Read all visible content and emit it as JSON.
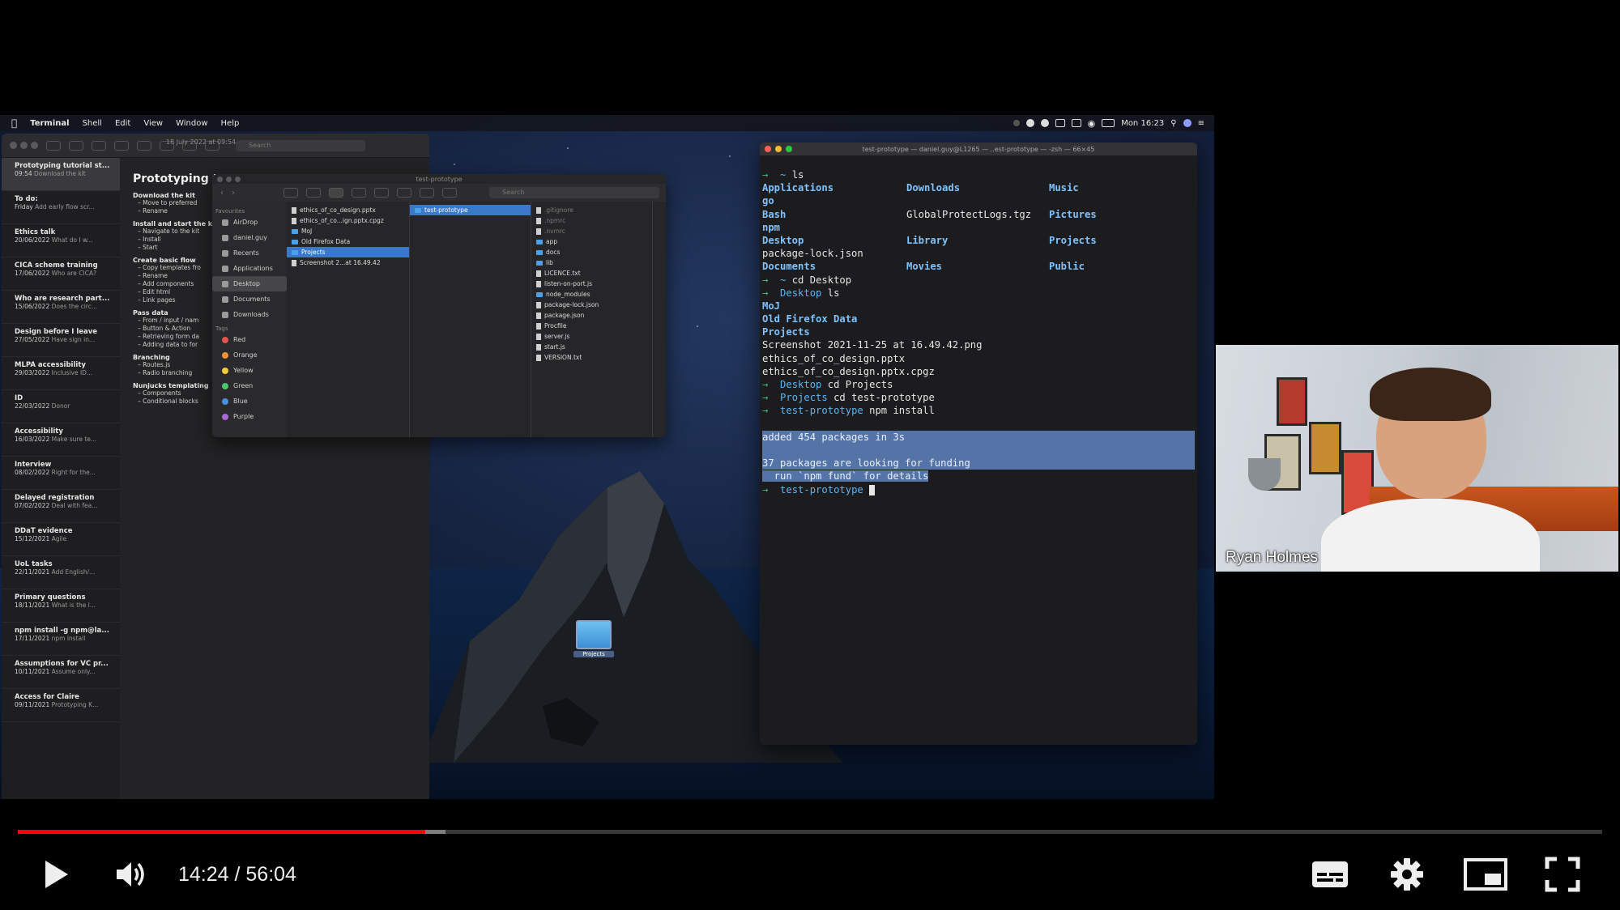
{
  "menubar": {
    "app": "Terminal",
    "items": [
      "Shell",
      "Edit",
      "View",
      "Window",
      "Help"
    ],
    "clock": "Mon 16:23"
  },
  "notes": {
    "search_placeholder": "Search",
    "list": [
      {
        "title": "Prototyping tutorial st...",
        "date": "09:54",
        "preview": "Download the kit"
      },
      {
        "title": "To do:",
        "date": "Friday",
        "preview": "Add early flow scr..."
      },
      {
        "title": "Ethics talk",
        "date": "20/06/2022",
        "preview": "What do I w..."
      },
      {
        "title": "CICA scheme training",
        "date": "17/06/2022",
        "preview": "Who are CICA?"
      },
      {
        "title": "Who are research part...",
        "date": "15/06/2022",
        "preview": "Does the circ..."
      },
      {
        "title": "Design before I leave",
        "date": "27/05/2022",
        "preview": "Have sign in..."
      },
      {
        "title": "MLPA accessibility",
        "date": "29/03/2022",
        "preview": "Inclusive ID..."
      },
      {
        "title": "ID",
        "date": "22/03/2022",
        "preview": "Donor"
      },
      {
        "title": "Accessibility",
        "date": "16/03/2022",
        "preview": "Make sure te..."
      },
      {
        "title": "Interview",
        "date": "08/02/2022",
        "preview": "Right for the..."
      },
      {
        "title": "Delayed registration",
        "date": "07/02/2022",
        "preview": "Deal with fea..."
      },
      {
        "title": "DDaT evidence",
        "date": "15/12/2021",
        "preview": "Agile"
      },
      {
        "title": "UoL tasks",
        "date": "22/11/2021",
        "preview": "Add English/..."
      },
      {
        "title": "Primary questions",
        "date": "18/11/2021",
        "preview": "What is the l..."
      },
      {
        "title": "npm install -g npm@la...",
        "date": "17/11/2021",
        "preview": "npm install"
      },
      {
        "title": "Assumptions for VC pr...",
        "date": "10/11/2021",
        "preview": "Assume only..."
      },
      {
        "title": "Access for Claire",
        "date": "09/11/2021",
        "preview": "Prototyping K..."
      }
    ],
    "note_date": "18 July 2022 at 09:54",
    "note_heading": "Prototyping tuto",
    "sections": [
      {
        "title": "Download the kit",
        "lines": [
          "Move to preferred",
          "Rename"
        ]
      },
      {
        "title": "Install and start the k",
        "lines": [
          "Navigate to the kit",
          "Install",
          "Start"
        ]
      },
      {
        "title": "Create basic flow",
        "lines": [
          "Copy templates fro",
          "Rename",
          "Add components",
          "Edit html",
          "Link pages"
        ]
      },
      {
        "title": "Pass data",
        "lines": [
          "From / input / nam",
          "Button & Action",
          "Retrieving form da",
          "Adding data to for"
        ]
      },
      {
        "title": "Branching",
        "lines": [
          "Routes.js",
          "Radio branching"
        ]
      },
      {
        "title": "Nunjucks templating",
        "lines": [
          "Components",
          "Conditional blocks"
        ]
      }
    ]
  },
  "finder": {
    "title": "test-prototype",
    "search_placeholder": "Search",
    "sidebar_favourites_label": "Favourites",
    "favourites": [
      "AirDrop",
      "daniel.guy",
      "Recents",
      "Applications",
      "Desktop",
      "Documents",
      "Downloads"
    ],
    "tags_label": "Tags",
    "tags": [
      {
        "name": "Red",
        "color": "#e5534b"
      },
      {
        "name": "Orange",
        "color": "#f0913a"
      },
      {
        "name": "Yellow",
        "color": "#f5c93a"
      },
      {
        "name": "Green",
        "color": "#4cc76b"
      },
      {
        "name": "Blue",
        "color": "#4a90e2"
      },
      {
        "name": "Purple",
        "color": "#a66bd6"
      }
    ],
    "col1": [
      "ethics_of_co_design.pptx",
      "ethics_of_co...ign.pptx.cpgz",
      "MoJ",
      "Old Firefox Data",
      "Projects",
      "Screenshot 2...at 16.49.42"
    ],
    "col2": [
      "test-prototype"
    ],
    "col3": [
      ".gitignore",
      ".npmrc",
      ".nvmrc",
      "app",
      "docs",
      "lib",
      "LICENCE.txt",
      "listen-on-port.js",
      "node_modules",
      "package-lock.json",
      "package.json",
      "Procfile",
      "server.js",
      "start.js",
      "VERSION.txt"
    ]
  },
  "desktop_icon": {
    "label": "Projects"
  },
  "terminal": {
    "title": "test-prototype — daniel.guy@L1265 — ..est-prototype — -zsh — 66×45",
    "lines": {
      "cmd1": "ls",
      "ls_rows": [
        [
          "Applications",
          "Downloads",
          "Music"
        ],
        [
          "go",
          "",
          ""
        ],
        [
          "Bash",
          "GlobalProtectLogs.tgz",
          "Pictures"
        ],
        [
          "npm",
          "",
          ""
        ],
        [
          "Desktop",
          "Library",
          "Projects"
        ],
        [
          "package-lock.json",
          "",
          ""
        ],
        [
          "Documents",
          "Movies",
          "Public"
        ]
      ],
      "cmd2": "cd Desktop",
      "prompt2": "Desktop",
      "cmd3": "ls",
      "desktop_ls": [
        "MoJ",
        "Old Firefox Data",
        "Projects",
        "Screenshot 2021-11-25 at 16.49.42.png",
        "ethics_of_co_design.pptx",
        "ethics_of_co_design.pptx.cpgz"
      ],
      "prompt4": "Desktop",
      "cmd4": "cd Projects",
      "prompt5": "Projects",
      "cmd5": "cd test-prototype",
      "prompt6": "test-prototype",
      "cmd6": "npm install",
      "out1": "added 454 packages in 3s",
      "out2": "37 packages are looking for funding",
      "out3": "  run `npm fund` for details",
      "prompt7": "test-prototype"
    }
  },
  "webcam": {
    "participant_name": "Ryan Holmes"
  },
  "player": {
    "time_current": "14:24",
    "time_total": "56:04",
    "time_display": "14:24 / 56:04",
    "progress_fraction": 0.257,
    "buffer_fraction": 0.27,
    "progress_color": "#ff0000"
  }
}
